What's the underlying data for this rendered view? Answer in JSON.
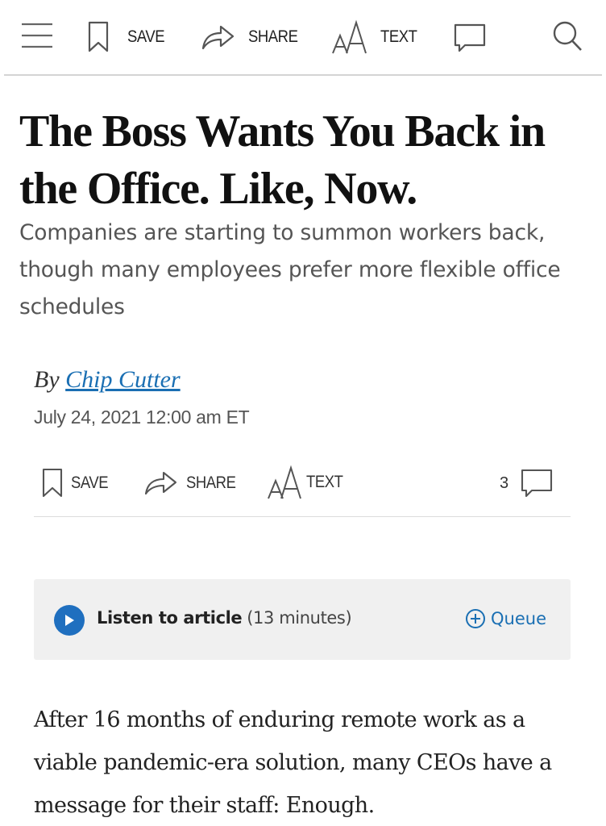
{
  "toolbar": {
    "save_label": "SAVE",
    "share_label": "SHARE",
    "text_label": "TEXT",
    "text_icon_glyph": "AA"
  },
  "article": {
    "headline": "The Boss Wants You Back in the Office. Like, Now.",
    "dek": "Companies are starting to summon workers back, though many employees prefer more flexible office schedules",
    "byline_prefix": "By",
    "author": "Chip Cutter",
    "date": "July 24, 2021 12:00 am ET",
    "body": "After 16 months of enduring remote work as a viable pandemic-era solution, many CEOs have a message for their staff: Enough."
  },
  "share_row": {
    "save_label": "SAVE",
    "share_label": "SHARE",
    "text_label": "TEXT",
    "comment_count": "3"
  },
  "audio": {
    "label": "Listen to article",
    "duration": "(13 minutes)",
    "queue_label": "Queue"
  },
  "colors": {
    "link": "#1a6fb3",
    "play_button": "#1f6fbf",
    "audio_bg": "#f0f0f0"
  },
  "icons": [
    "menu-icon",
    "bookmark-icon",
    "share-arrow-icon",
    "text-size-icon",
    "comment-icon",
    "search-icon",
    "play-icon",
    "plus-circle-icon"
  ]
}
